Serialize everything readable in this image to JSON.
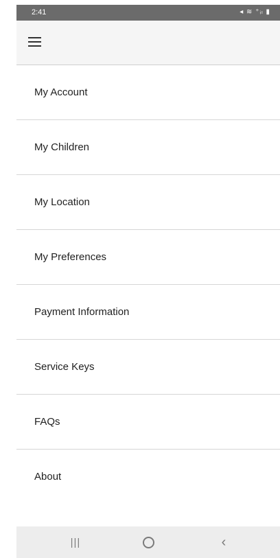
{
  "status_bar": {
    "time": "2:41",
    "icons_text": "◂ ≋ ⁺ᵢₗ ▮",
    "icon_names": [
      "mute-icon",
      "wifi-icon",
      "signal-icon",
      "battery-icon"
    ]
  },
  "app_bar": {
    "menu_icon": "hamburger-menu-icon"
  },
  "menu": {
    "items": [
      {
        "label": "My Account"
      },
      {
        "label": "My Children"
      },
      {
        "label": "My Location"
      },
      {
        "label": "My Preferences"
      },
      {
        "label": "Payment Information"
      },
      {
        "label": "Service Keys"
      },
      {
        "label": "FAQs"
      },
      {
        "label": "About"
      }
    ]
  },
  "nav_bar": {
    "recent_glyph": "|||",
    "back_glyph": "‹",
    "icon_names": [
      "recent-apps-icon",
      "home-icon",
      "back-icon"
    ]
  },
  "colors": {
    "status_bar_bg": "#6b6b6b",
    "app_bar_bg": "#f5f5f5",
    "divider": "#d6d6d6",
    "nav_bar_bg": "#ededed"
  }
}
